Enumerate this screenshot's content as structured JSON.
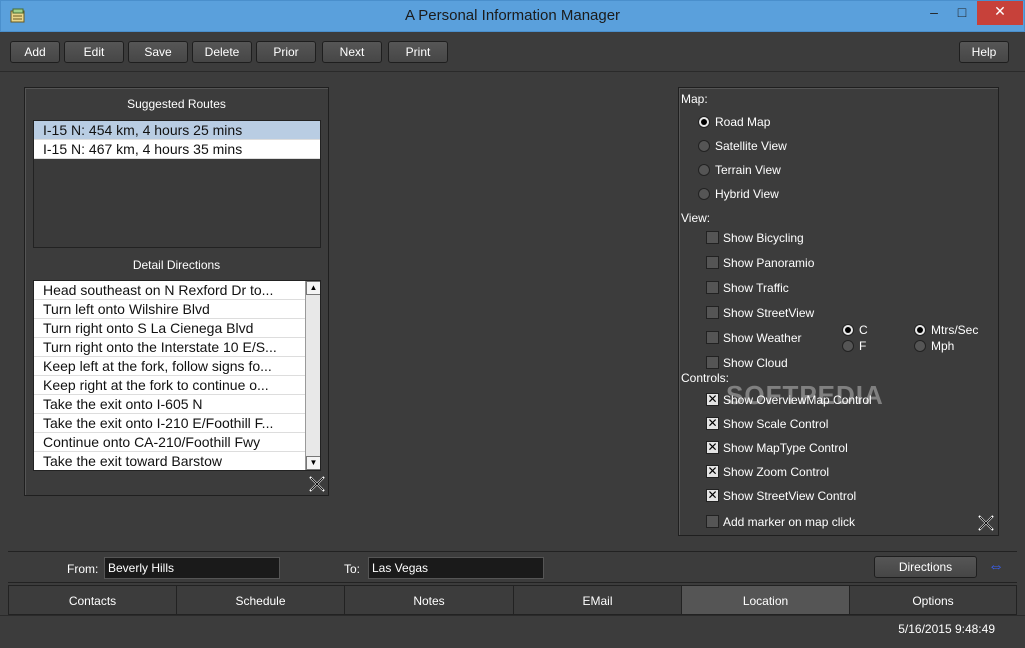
{
  "window": {
    "title": "A Personal Information Manager",
    "minimize": "‒",
    "maximize": "□",
    "close": "✕"
  },
  "toolbar": {
    "add": "Add",
    "edit": "Edit",
    "save": "Save",
    "delete": "Delete",
    "prior": "Prior",
    "next": "Next",
    "print": "Print",
    "help": "Help"
  },
  "routes": {
    "title": "Suggested Routes",
    "items": [
      "I-15 N: 454 km, 4 hours 25 mins",
      "I-15 N: 467 km, 4 hours 35 mins"
    ]
  },
  "directions": {
    "title": "Detail Directions",
    "items": [
      "Head southeast on N Rexford Dr to...",
      "Turn left onto Wilshire Blvd",
      "Turn right onto S La Cienega Blvd",
      "Turn right onto the Interstate 10 E/S...",
      "Keep left at the fork, follow signs fo...",
      "Keep right at the fork to continue o...",
      "Take the exit onto I-605 N",
      "Take the exit onto I-210 E/Foothill F...",
      "Continue onto CA-210/Foothill Fwy",
      "Take the exit toward Barstow"
    ]
  },
  "map_options": {
    "map_label": "Map:",
    "map_types": [
      {
        "label": "Road Map",
        "selected": true
      },
      {
        "label": "Satellite View",
        "selected": false
      },
      {
        "label": "Terrain View",
        "selected": false
      },
      {
        "label": "Hybrid View",
        "selected": false
      }
    ],
    "view_label": "View:",
    "view_options": [
      {
        "label": "Show Bicycling",
        "checked": false
      },
      {
        "label": "Show Panoramio",
        "checked": false
      },
      {
        "label": "Show Traffic",
        "checked": false
      },
      {
        "label": "Show StreetView",
        "checked": false
      },
      {
        "label": "Show Weather",
        "checked": false
      },
      {
        "label": "Show Cloud",
        "checked": false
      }
    ],
    "temp_units": [
      {
        "label": "C",
        "selected": true
      },
      {
        "label": "F",
        "selected": false
      }
    ],
    "speed_units": [
      {
        "label": "Mtrs/Sec",
        "selected": true
      },
      {
        "label": "Mph",
        "selected": false
      }
    ],
    "controls_label": "Controls:",
    "controls": [
      {
        "label": "Show OverviewMap Control",
        "checked": true
      },
      {
        "label": "Show Scale Control",
        "checked": true
      },
      {
        "label": "Show MapType Control",
        "checked": true
      },
      {
        "label": "Show Zoom Control",
        "checked": true
      },
      {
        "label": "Show StreetView Control",
        "checked": true
      },
      {
        "label": "Add marker on map click",
        "checked": false
      }
    ],
    "check_mark": "✕"
  },
  "watermark": "SOFTPEDIA",
  "address": {
    "from_label": "From:",
    "from_value": "Beverly Hills",
    "to_label": "To:",
    "to_value": "Las Vegas",
    "directions_button": "Directions",
    "swap_icon_glyph": "⇔"
  },
  "tabs": [
    {
      "label": "Contacts",
      "active": false
    },
    {
      "label": "Schedule",
      "active": false
    },
    {
      "label": "Notes",
      "active": false
    },
    {
      "label": "EMail",
      "active": false
    },
    {
      "label": "Location",
      "active": true
    },
    {
      "label": "Options",
      "active": false
    }
  ],
  "status": {
    "datetime": "5/16/2015 9:48:49"
  },
  "colors": {
    "accent": "#5aa0dc",
    "background": "#3c3c3c",
    "close": "#c7413a",
    "swap_icon": "#3a62ff",
    "selection": "#b9cde3"
  }
}
